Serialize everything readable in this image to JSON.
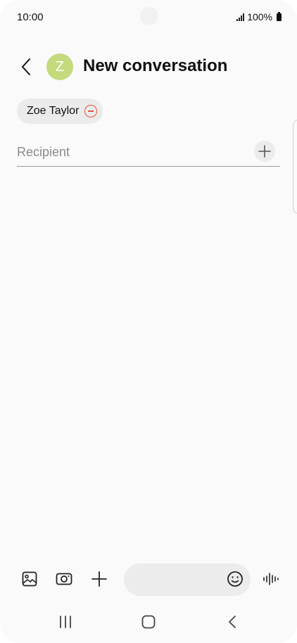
{
  "status_bar": {
    "time": "10:00",
    "battery": "100%"
  },
  "header": {
    "avatar_initial": "Z",
    "title": "New conversation",
    "avatar_color": "#c5d97d"
  },
  "recipients": {
    "chips": [
      {
        "name": "Zoe Taylor"
      }
    ],
    "input_placeholder": "Recipient",
    "input_value": ""
  },
  "composer": {
    "message_value": "",
    "tools": [
      "gallery-icon",
      "camera-icon",
      "plus-icon"
    ],
    "voice_icon": "voice-waveform-icon",
    "emoji_icon": "emoji-icon"
  },
  "colors": {
    "remove_accent": "#e5553c",
    "background": "#fafafa"
  }
}
